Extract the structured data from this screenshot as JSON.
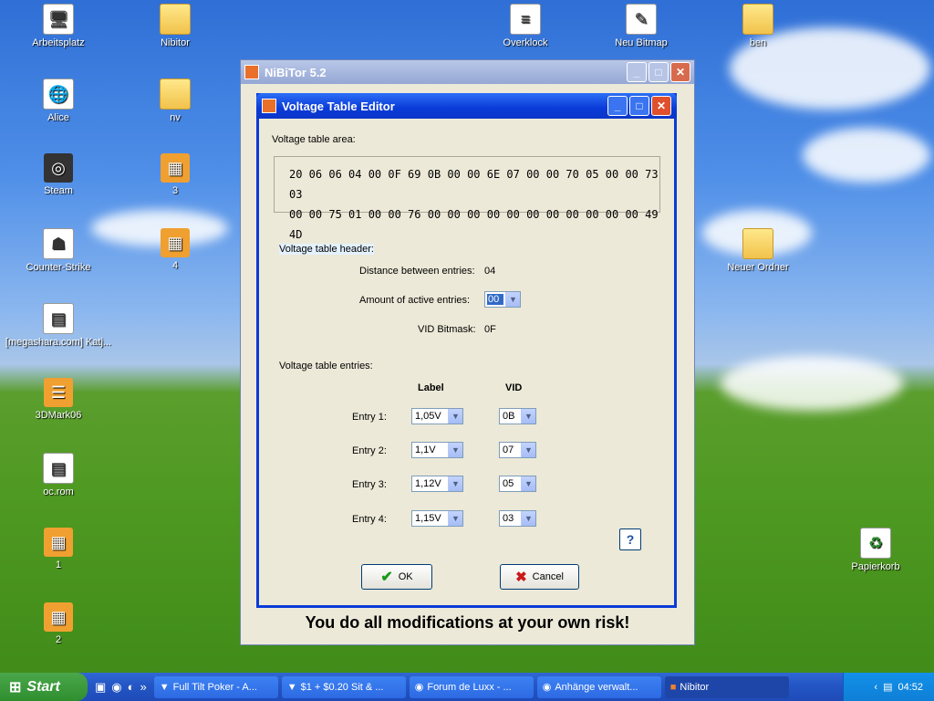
{
  "desktop": {
    "icons": [
      {
        "label": "Arbeitsplatz"
      },
      {
        "label": "Nibitor"
      },
      {
        "label": "Overklock"
      },
      {
        "label": "Neu Bitmap"
      },
      {
        "label": "ben"
      },
      {
        "label": "Alice"
      },
      {
        "label": "nv"
      },
      {
        "label": "Steam"
      },
      {
        "label": "3"
      },
      {
        "label": "Counter-Strike"
      },
      {
        "label": "4"
      },
      {
        "label": "Neuer Ordner"
      },
      {
        "label": "[megashara.com] Katj..."
      },
      {
        "label": "3DMark06"
      },
      {
        "label": "oc.rom"
      },
      {
        "label": "1"
      },
      {
        "label": "2"
      },
      {
        "label": "Papierkorb"
      }
    ]
  },
  "main_window": {
    "title": "NiBiTor 5.2",
    "warning": "You do all modifications at your own risk!"
  },
  "dialog": {
    "title": "Voltage Table Editor",
    "area_label": "Voltage table area:",
    "hex_line1": "20 06 06 04 00 0F 69 0B 00 00 6E 07 00 00 70 05 00 00 73 03",
    "hex_line2": "00 00 75 01 00 00 76 00 00 00 00 00 00 00 00 00 00 00 49 4D",
    "header_label": "Voltage table header:",
    "distance_label": "Distance between entries:",
    "distance_value": "04",
    "active_label": "Amount of active entries:",
    "active_value": "00",
    "bitmask_label": "VID Bitmask:",
    "bitmask_value": "0F",
    "entries_label": "Voltage table entries:",
    "col_label": "Label",
    "col_vid": "VID",
    "entries": [
      {
        "name": "Entry 1:",
        "label": "1,05V",
        "vid": "0B"
      },
      {
        "name": "Entry 2:",
        "label": "1,1V",
        "vid": "07"
      },
      {
        "name": "Entry 3:",
        "label": "1,12V",
        "vid": "05"
      },
      {
        "name": "Entry 4:",
        "label": "1,15V",
        "vid": "03"
      }
    ],
    "help": "?",
    "ok": "OK",
    "cancel": "Cancel"
  },
  "taskbar": {
    "start": "Start",
    "tasks": [
      {
        "label": "Full Tilt Poker - A..."
      },
      {
        "label": "$1 + $0.20 Sit & ..."
      },
      {
        "label": "Forum de Luxx - ..."
      },
      {
        "label": "Anhänge verwalt..."
      },
      {
        "label": "Nibitor"
      }
    ],
    "clock": "04:52"
  }
}
